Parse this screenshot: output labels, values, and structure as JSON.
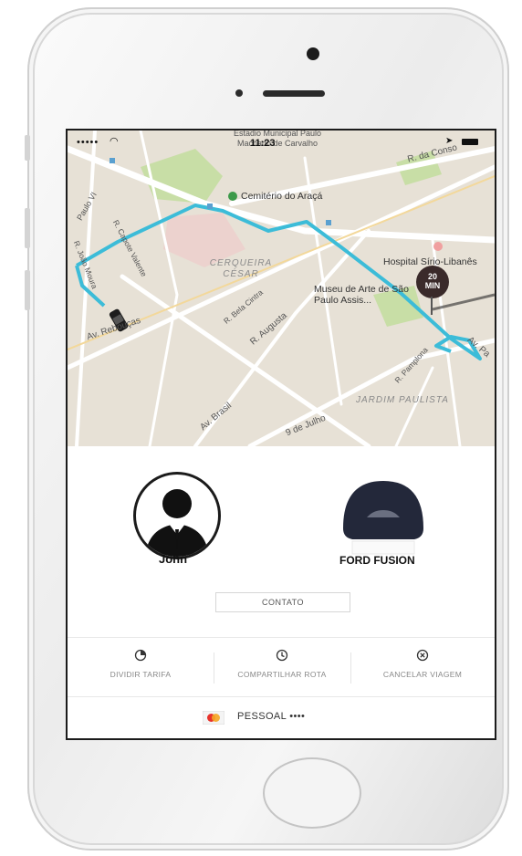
{
  "status_bar": {
    "signal": "•••••",
    "time": "11:23"
  },
  "map": {
    "top_street": "Estadio Municipal Paulo Machado de Carvalho",
    "labels": {
      "cemiterio": "Cemitério do Araçá",
      "consolacao": "R. da Conso",
      "paulo_vi": "Paulo VI",
      "capote_valente": "R. Capote Valente",
      "joao_moura": "R. João Moura",
      "cerqueira_cesar": "CERQUEIRA CÉSAR",
      "bela_cintra": "R. Bela Cintra",
      "augusta": "R. Augusta",
      "museu": "Museu de Arte de São Paulo Assis...",
      "hospital": "Hospital Sírio-Libanês",
      "rebougas": "Av. Rebouças",
      "brasil": "Av. Brasil",
      "nove_julho": "9 de Julho",
      "pamplona": "R. Pamplona",
      "jardim_paulista": "JARDIM PAULISTA",
      "av_paulista": "Av. Pa"
    },
    "eta": {
      "value": "20",
      "unit": "MIN"
    }
  },
  "trip": {
    "driver_name": "John",
    "car_model": "FORD FUSION",
    "contact_label": "CONTATO"
  },
  "actions": [
    {
      "label": "DIVIDIR TARIFA",
      "icon": "split-fare-icon"
    },
    {
      "label": "COMPARTILHAR ROTA",
      "icon": "clock-icon"
    },
    {
      "label": "CANCELAR VIAGEM",
      "icon": "cancel-icon"
    }
  ],
  "payment": {
    "label": "PESSOAL ••••",
    "icon": "mastercard-icon"
  },
  "colors": {
    "route": "#3cbcd8",
    "map_bg": "#e7e1d6",
    "park": "#c8dea6",
    "eta_pin": "#3a2a2a"
  }
}
